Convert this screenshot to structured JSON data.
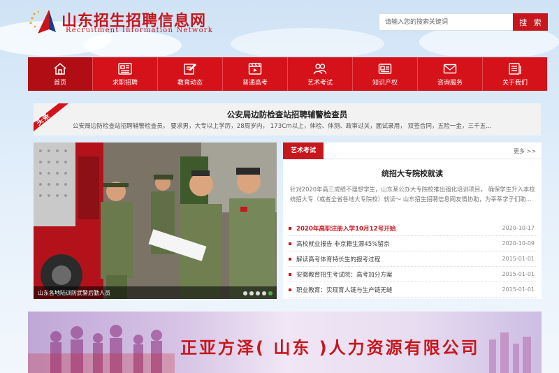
{
  "header": {
    "site_title": "山东招生招聘信息网",
    "site_subtitle": "Recruitment Information Network",
    "logo_icon": "star-sail-logo",
    "search": {
      "placeholder": "请输入您的搜索关键词",
      "value": "",
      "button_label": "搜 索"
    }
  },
  "nav": {
    "items": [
      {
        "label": "首页",
        "icon": "home-icon",
        "active": true
      },
      {
        "label": "求职招聘",
        "icon": "newspaper-icon",
        "active": false
      },
      {
        "label": "教育动态",
        "icon": "edit-icon",
        "active": false
      },
      {
        "label": "普通高考",
        "icon": "film-icon",
        "active": false
      },
      {
        "label": "艺术考试",
        "icon": "users-icon",
        "active": false
      },
      {
        "label": "知识产权",
        "icon": "id-card-icon",
        "active": false
      },
      {
        "label": "咨询服务",
        "icon": "mail-icon",
        "active": false
      },
      {
        "label": "关于我们",
        "icon": "document-list-icon",
        "active": false
      }
    ]
  },
  "headline": {
    "ribbon": "头条",
    "title": "公安局边防检查站招聘辅警检查员",
    "summary": "公安局边防检查站招聘辅警检查员。 要求男，大专以上学历，28周岁内， 173Cm以上，体检、体测、政审过关，面试录用， 双签合同，五险一金，三千五..."
  },
  "slideshow": {
    "caption": "山东各地陆训防武警后勤人员",
    "dots": 5,
    "active_dot": 4
  },
  "art_exam": {
    "tab": "艺术考试",
    "more": "更多 >>",
    "feature_title": "统招大专院校就读",
    "feature_desc": "针对2020年高三成绩不理想学生，山东某公办大专院校推出强化培训项目， 确保学生升入本校统招大专（或者全省各地大专院校）就读～ 山东招生招聘信息网友情协助，为莘莘学子们助...",
    "news": [
      {
        "title": "2020年高职注册入学10月12号开始",
        "date": "2020-10-17",
        "hot": true
      },
      {
        "title": "高校就业报告 非京籍生源45%留京",
        "date": "2020-10-09",
        "hot": false
      },
      {
        "title": "解读高考体育特长生的报考过程",
        "date": "2015-01-01",
        "hot": false
      },
      {
        "title": "安徽教育招生考试院：高考加分方案",
        "date": "2015-01-01",
        "hot": false
      },
      {
        "title": "职业教育：实现育人链与生产链无缝",
        "date": "2015-01-01",
        "hot": false
      }
    ]
  },
  "banner": {
    "text": "正亚方泽( 山东 )人力资源有限公司"
  },
  "colors": {
    "brand_red": "#c8161d",
    "nav_red": "#d5121a",
    "nav_active": "#b00d14"
  }
}
